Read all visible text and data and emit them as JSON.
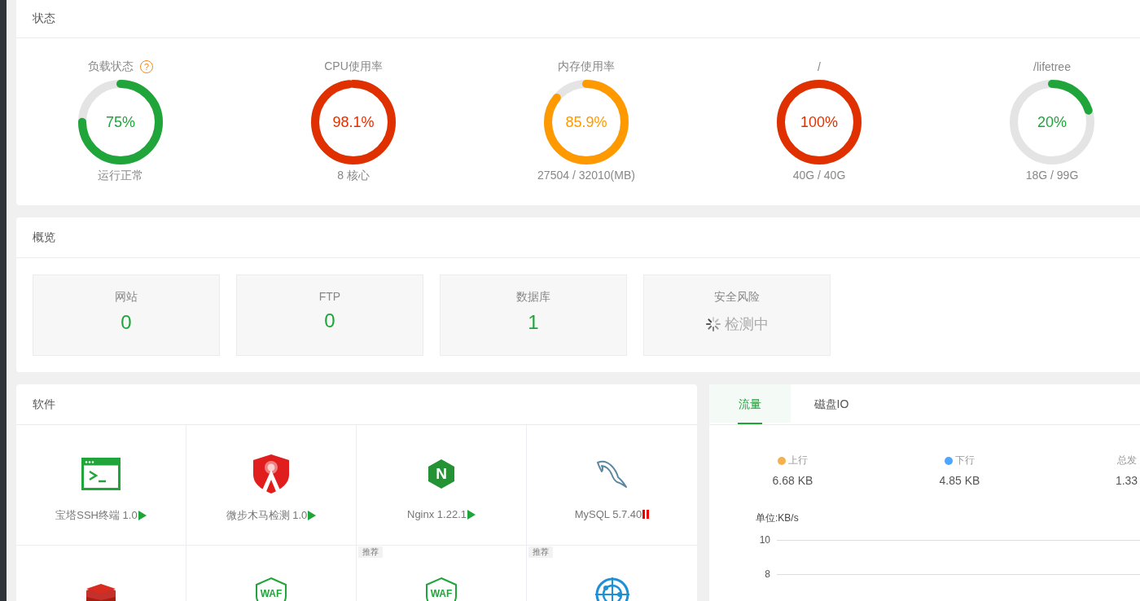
{
  "status": {
    "title": "状态",
    "gauges": [
      {
        "label": "负载状态",
        "help": "?",
        "level": 0.75,
        "value": "75%",
        "detail": "运行正常"
      },
      {
        "label": "CPU使用率",
        "level": 0.981,
        "value": "98.1%",
        "detail": "8 核心"
      },
      {
        "label": "内存使用率",
        "level": 0.859,
        "value": "85.9%",
        "detail": "27504 / 32010(MB)"
      },
      {
        "label": "/",
        "level": 1,
        "value": "100%",
        "detail": "40G / 40G"
      },
      {
        "label": "/lifetree",
        "level": 0.2,
        "value": "20%",
        "detail": "18G / 99G"
      }
    ]
  },
  "overview": {
    "title": "概览",
    "cards": [
      {
        "kind": "count",
        "label": "网站",
        "value": "0"
      },
      {
        "kind": "count",
        "label": "FTP",
        "value": "0"
      },
      {
        "kind": "count",
        "label": "数据库",
        "value": "1"
      },
      {
        "kind": "loading",
        "label": "安全风险",
        "value": "检测中"
      }
    ]
  },
  "software": {
    "title": "软件",
    "items": [
      {
        "kind": "terminal",
        "name": "宝塔SSH终端 1.0",
        "running": true
      },
      {
        "kind": "shield",
        "name": "微步木马检测 1.0",
        "running": true
      },
      {
        "kind": "hexagon",
        "mark": "N",
        "name": "Nginx 1.22.1",
        "running": true
      },
      {
        "kind": "dolphin",
        "name": "MySQL 5.7.40",
        "running": false
      },
      {
        "kind": "stack"
      },
      {
        "kind": "waf",
        "mark": "WAF"
      },
      {
        "kind": "waf",
        "mark": "WAF",
        "badge": "推荐"
      },
      {
        "kind": "radar",
        "badge": "推荐"
      }
    ]
  },
  "traffic": {
    "tabs": [
      {
        "label": "流量",
        "selected": true
      },
      {
        "label": "磁盘IO",
        "selected": false
      }
    ],
    "stats": [
      {
        "label": "上行",
        "value": "6.68 KB",
        "color": "#f5b14c"
      },
      {
        "label": "下行",
        "value": "4.85 KB",
        "color": "#4da6ff"
      },
      {
        "label": "总发",
        "value": "1.33"
      }
    ],
    "chart": {
      "unit": "单位:KB/s",
      "yticks": [
        "10",
        "8"
      ]
    }
  }
}
